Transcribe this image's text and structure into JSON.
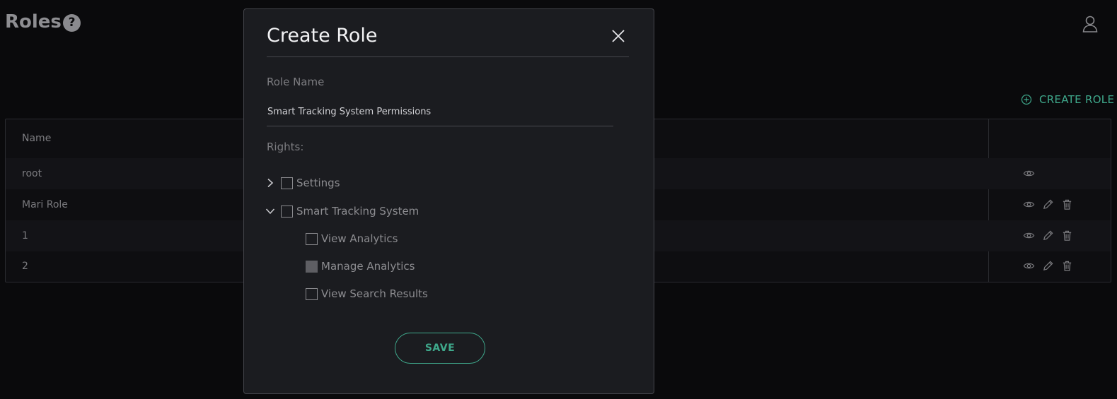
{
  "page": {
    "title": "Roles",
    "help_glyph": "?",
    "create_role_label": "CREATE ROLE"
  },
  "table": {
    "header_name": "Name",
    "rows": [
      {
        "name": "root",
        "actions": [
          "view-icon"
        ]
      },
      {
        "name": "Mari Role",
        "actions": [
          "view-icon",
          "edit-icon",
          "delete-icon"
        ]
      },
      {
        "name": "1",
        "actions": [
          "view-icon",
          "edit-icon",
          "delete-icon"
        ]
      },
      {
        "name": "2",
        "actions": [
          "view-icon",
          "edit-icon",
          "delete-icon"
        ]
      }
    ]
  },
  "modal": {
    "title": "Create Role",
    "role_name_label": "Role Name",
    "role_name_value": "Smart Tracking System Permissions",
    "rights_label": "Rights:",
    "tree": [
      {
        "label": "Settings",
        "expanded": false,
        "checked": false
      },
      {
        "label": "Smart Tracking System",
        "expanded": true,
        "checked": false,
        "children": [
          {
            "label": "View Analytics",
            "checked": false
          },
          {
            "label": "Manage Analytics",
            "checked": "indeterminate"
          },
          {
            "label": "View Search Results",
            "checked": false
          }
        ]
      }
    ],
    "save_label": "SAVE"
  },
  "colors": {
    "accent": "#3fa98c",
    "background": "#0a0a0c",
    "modal_bg": "#1b1c20"
  }
}
